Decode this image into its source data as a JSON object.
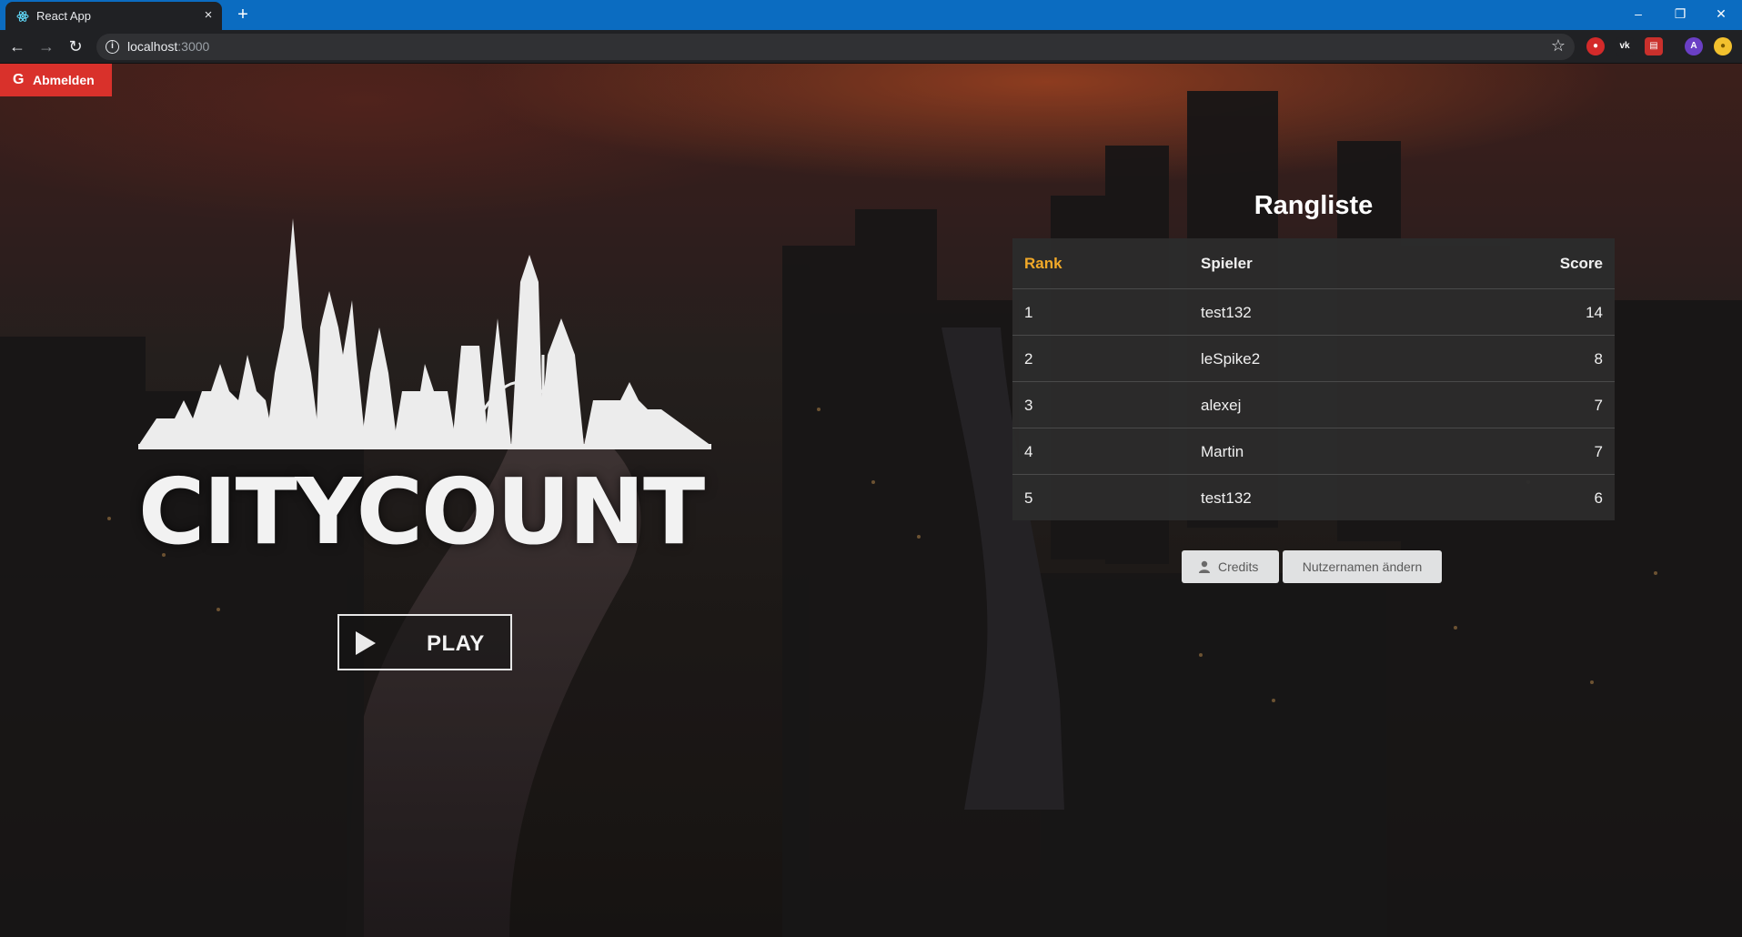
{
  "browser": {
    "tab_title": "React App",
    "tab_close": "×",
    "new_tab": "+",
    "url_host": "localhost",
    "url_port": ":3000",
    "window": {
      "minimize": "–",
      "restore": "❐",
      "close": "✕"
    },
    "extensions": [
      "vk-icon",
      "pdf-icon",
      "profile-avatar",
      "coin-icon"
    ],
    "avatar_letter": "A"
  },
  "auth": {
    "logout_label": "Abmelden",
    "logout_icon": "G"
  },
  "logo": {
    "text": "CITYCOUNT"
  },
  "play": {
    "label": "PLAY"
  },
  "leaderboard": {
    "title": "Rangliste",
    "headers": {
      "rank": "Rank",
      "player": "Spieler",
      "score": "Score"
    },
    "rows": [
      {
        "rank": "1",
        "player": "test132",
        "score": "14"
      },
      {
        "rank": "2",
        "player": "leSpike2",
        "score": "8"
      },
      {
        "rank": "3",
        "player": "alexej",
        "score": "7"
      },
      {
        "rank": "4",
        "player": "Martin",
        "score": "7"
      },
      {
        "rank": "5",
        "player": "test132",
        "score": "6"
      }
    ]
  },
  "actions": {
    "credits_label": "Credits",
    "rename_label": "Nutzernamen ändern"
  },
  "colors": {
    "accent_rank": "#f2a928",
    "logout": "#d9312b",
    "browser_bar": "#0b6cc1"
  }
}
